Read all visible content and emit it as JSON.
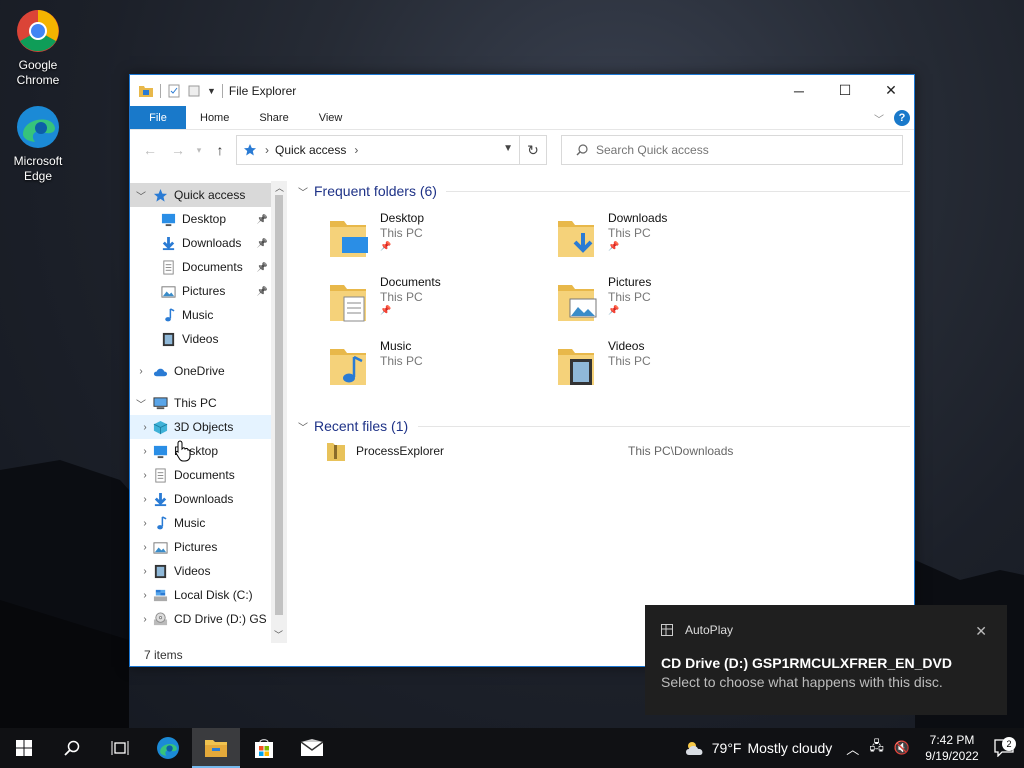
{
  "desktop": {
    "icons": [
      {
        "label": "Google Chrome"
      },
      {
        "label": "Microsoft Edge"
      }
    ]
  },
  "window": {
    "title": "File Explorer",
    "ribbon_tabs": [
      "File",
      "Home",
      "Share",
      "View"
    ],
    "address": {
      "crumb": "Quick access"
    },
    "search": {
      "placeholder": "Search Quick access"
    },
    "nav_pane": [
      {
        "label": "Quick access",
        "icon": "star-icon",
        "level": 0,
        "pinned": false
      },
      {
        "label": "Desktop",
        "icon": "desktop-icon",
        "level": 1,
        "pinned": true
      },
      {
        "label": "Downloads",
        "icon": "download-icon",
        "level": 1,
        "pinned": true
      },
      {
        "label": "Documents",
        "icon": "document-icon",
        "level": 1,
        "pinned": true
      },
      {
        "label": "Pictures",
        "icon": "picture-icon",
        "level": 1,
        "pinned": true
      },
      {
        "label": "Music",
        "icon": "music-icon",
        "level": 1,
        "pinned": false
      },
      {
        "label": "Videos",
        "icon": "video-icon",
        "level": 1,
        "pinned": false
      },
      {
        "label": "OneDrive",
        "icon": "cloud-icon",
        "level": 0,
        "pinned": false
      },
      {
        "label": "This PC",
        "icon": "computer-icon",
        "level": 0,
        "pinned": false
      },
      {
        "label": "3D Objects",
        "icon": "cube-icon",
        "level": 1,
        "pinned": false
      },
      {
        "label": "Desktop",
        "icon": "desktop-icon",
        "level": 1,
        "pinned": false
      },
      {
        "label": "Documents",
        "icon": "document-icon",
        "level": 1,
        "pinned": false
      },
      {
        "label": "Downloads",
        "icon": "download-icon",
        "level": 1,
        "pinned": false
      },
      {
        "label": "Music",
        "icon": "music-icon",
        "level": 1,
        "pinned": false
      },
      {
        "label": "Pictures",
        "icon": "picture-icon",
        "level": 1,
        "pinned": false
      },
      {
        "label": "Videos",
        "icon": "video-icon",
        "level": 1,
        "pinned": false
      },
      {
        "label": "Local Disk (C:)",
        "icon": "disk-icon",
        "level": 1,
        "pinned": false
      },
      {
        "label": "CD Drive (D:) GS",
        "icon": "cd-icon",
        "level": 1,
        "pinned": false
      }
    ],
    "frequent": {
      "heading": "Frequent folders (6)",
      "items": [
        {
          "name": "Desktop",
          "sub": "This PC",
          "pinned": true
        },
        {
          "name": "Downloads",
          "sub": "This PC",
          "pinned": true
        },
        {
          "name": "Documents",
          "sub": "This PC",
          "pinned": true
        },
        {
          "name": "Pictures",
          "sub": "This PC",
          "pinned": true
        },
        {
          "name": "Music",
          "sub": "This PC",
          "pinned": false
        },
        {
          "name": "Videos",
          "sub": "This PC",
          "pinned": false
        }
      ]
    },
    "recent": {
      "heading": "Recent files (1)",
      "items": [
        {
          "name": "ProcessExplorer",
          "path": "This PC\\Downloads"
        }
      ]
    },
    "status": "7 items"
  },
  "toast": {
    "app": "AutoPlay",
    "title": "CD Drive (D:) GSP1RMCULXFRER_EN_DVD",
    "body": "Select to choose what happens with this disc."
  },
  "taskbar": {
    "weather_temp": "79°F",
    "weather_desc": "Mostly cloudy",
    "time": "7:42 PM",
    "date": "9/19/2022",
    "notif_count": "2"
  }
}
